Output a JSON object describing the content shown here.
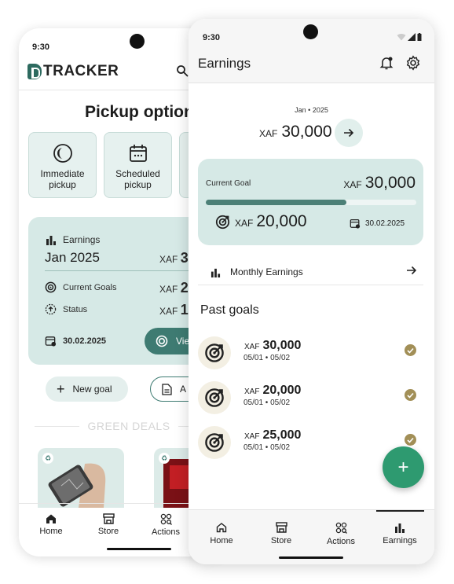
{
  "back_screen": {
    "status_time": "9:30",
    "logo_text": "TRACKER",
    "title": "Pickup options",
    "options": [
      {
        "label": "Immediate pickup",
        "icon": "half-moon-icon"
      },
      {
        "label": "Scheduled pickup",
        "icon": "calendar-icon"
      }
    ],
    "earnings_card": {
      "heading": "Earnings",
      "period": "Jan 2025",
      "currency": "XAF",
      "period_amount": "3",
      "current_goals_label": "Current Goals",
      "current_goals_amount": "2",
      "status_label": "Status",
      "status_amount": "1",
      "date": "30.02.2025",
      "view_button": "Vie"
    },
    "new_goal_button": "New goal",
    "secondary_button": "A",
    "deals_heading": "GREEN DEALS",
    "nav": [
      {
        "label": "Home",
        "icon": "home-icon"
      },
      {
        "label": "Store",
        "icon": "store-icon"
      },
      {
        "label": "Actions",
        "icon": "actions-icon"
      }
    ]
  },
  "front_screen": {
    "status_time": "9:30",
    "title": "Earnings",
    "month_label": "Jan • 2025",
    "currency": "XAF",
    "month_total": "30,000",
    "current_goal": {
      "label": "Current Goal",
      "target": "30,000",
      "achieved": "20,000",
      "progress_fraction": 0.667,
      "due_date": "30.02.2025"
    },
    "monthly_earnings_label": "Monthly Earnings",
    "past_goals_heading": "Past goals",
    "past_goals": [
      {
        "amount": "30,000",
        "range": "05/01 • 05/02"
      },
      {
        "amount": "20,000",
        "range": "05/01 • 05/02"
      },
      {
        "amount": "25,000",
        "range": "05/01 • 05/02"
      }
    ],
    "fab_symbol": "+",
    "nav": [
      {
        "label": "Home",
        "icon": "home-icon"
      },
      {
        "label": "Store",
        "icon": "store-icon"
      },
      {
        "label": "Actions",
        "icon": "actions-icon"
      },
      {
        "label": "Earnings",
        "icon": "bar-chart-icon"
      }
    ],
    "active_nav": "Earnings"
  },
  "colors": {
    "accent": "#3e7b72",
    "card_bg": "#d6e9e6",
    "fab": "#2e9a70",
    "check": "#a28f57"
  }
}
